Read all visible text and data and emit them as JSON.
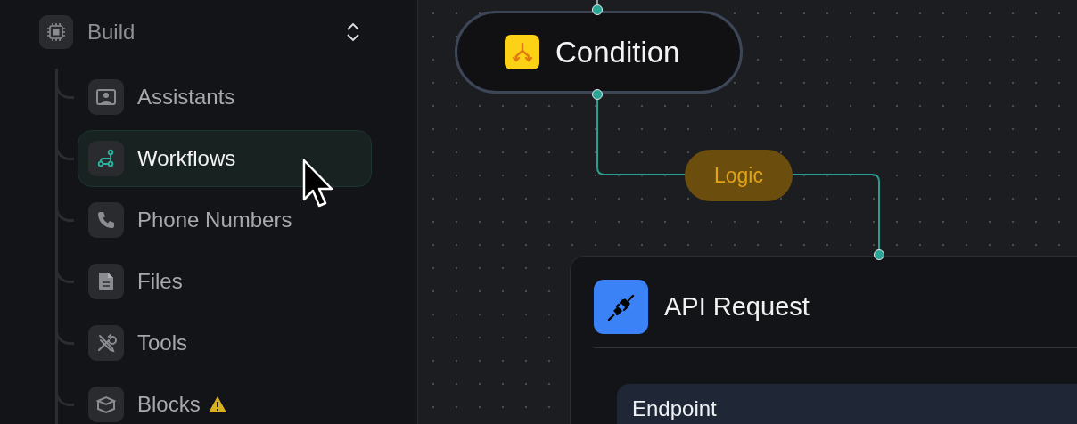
{
  "sidebar": {
    "section": {
      "title": "Build"
    },
    "items": [
      {
        "label": "Assistants",
        "selected": false,
        "warning": false
      },
      {
        "label": "Workflows",
        "selected": true,
        "warning": false
      },
      {
        "label": "Phone Numbers",
        "selected": false,
        "warning": false
      },
      {
        "label": "Files",
        "selected": false,
        "warning": false
      },
      {
        "label": "Tools",
        "selected": false,
        "warning": false
      },
      {
        "label": "Blocks",
        "selected": false,
        "warning": true
      }
    ]
  },
  "canvas": {
    "condition_node": {
      "title": "Condition"
    },
    "edge_label": "Logic",
    "api_node": {
      "title": "API Request",
      "field_label": "Endpoint"
    }
  }
}
